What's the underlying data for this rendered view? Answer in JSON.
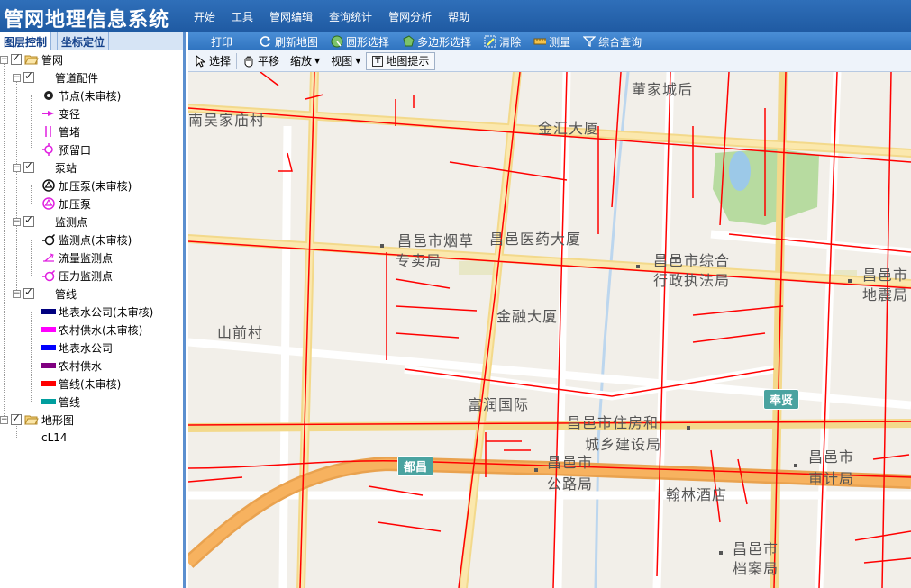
{
  "app": {
    "title": "管网地理信息系统"
  },
  "menu": [
    "开始",
    "工具",
    "管网编辑",
    "查询统计",
    "管网分析",
    "帮助"
  ],
  "sidebar": {
    "tabs": [
      "图层控制",
      "坐标定位"
    ],
    "tree": {
      "root": "管网",
      "fittings": {
        "label": "管道配件",
        "items": [
          "节点(未审核)",
          "变径",
          "管堵",
          "预留口"
        ]
      },
      "pump": {
        "label": "泵站",
        "items": [
          "加压泵(未审核)",
          "加压泵"
        ]
      },
      "monitor": {
        "label": "监测点",
        "items": [
          "监测点(未审核)",
          "流量监测点",
          "压力监测点"
        ]
      },
      "pipes": {
        "label": "管线",
        "items": [
          "地表水公司(未审核)",
          "农村供水(未审核)",
          "地表水公司",
          "农村供水",
          "管线(未审核)",
          "管线"
        ]
      },
      "terrain": "地形图",
      "terrain_child": "cL14"
    },
    "colors": {
      "surface_unreviewed": "#00007f",
      "rural_unreviewed": "#ff00ff",
      "surface": "#0000ff",
      "rural": "#800080",
      "pipe_unreviewed": "#ff0000",
      "pipe": "#009e9e"
    }
  },
  "toolbar1": {
    "print": "打印",
    "refresh": "刷新地图",
    "circle_select": "圆形选择",
    "polygon_select": "多边形选择",
    "clear": "清除",
    "measure": "测量",
    "query": "综合查询"
  },
  "toolbar2": {
    "select": "选择",
    "pan": "平移",
    "zoom": "缩放",
    "view": "视图",
    "map_tip": "地图提示"
  },
  "map": {
    "labels": {
      "dongjia": "董家城后",
      "nanwu": "南吴家庙村",
      "jinhui": "金汇大厦",
      "tobacco1": "昌邑市烟草",
      "tobacco2": "专卖局",
      "medicine": "昌邑医药大厦",
      "law1": "昌邑市综合",
      "law2": "行政执法局",
      "quake1": "昌邑市",
      "quake2": "地震局",
      "jinrong": "金融大厦",
      "shanqian": "山前村",
      "furun": "富润国际",
      "housing1": "昌邑市住房和",
      "housing2": "城乡建设局",
      "highway1": "昌邑市",
      "highway2": "公路局",
      "audit1": "昌邑市",
      "audit2": "审计局",
      "hanlin": "翰林酒店",
      "archive1": "昌邑市",
      "archive2": "档案局"
    },
    "shields": {
      "dukou": "都昌",
      "fengxian": "奉贤"
    }
  }
}
